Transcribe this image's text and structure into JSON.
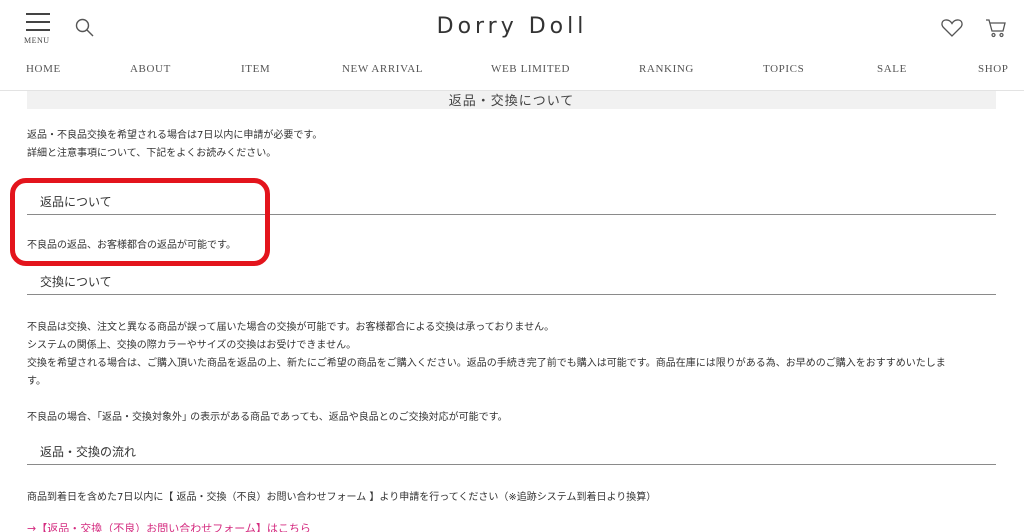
{
  "header": {
    "menu_label": "MENU",
    "logo": "Dorry Doll",
    "nav": [
      "HOME",
      "ABOUT",
      "ITEM",
      "NEW ARRIVAL",
      "WEB LIMITED",
      "RANKING",
      "TOPICS",
      "SALE",
      "SHOP"
    ]
  },
  "page_title": "返品・交換について",
  "intro": [
    "返品・不良品交換を希望される場合は7日以内に申請が必要です。",
    "詳細と注意事項について、下記をよくお読みください。"
  ],
  "sections": {
    "returns": {
      "heading": "返品について",
      "body": "不良品の返品、お客様都合の返品が可能です。"
    },
    "exchange": {
      "heading": "交換について",
      "lines": [
        "不良品は交換、注文と異なる商品が誤って届いた場合の交換が可能です。お客様都合による交換は承っておりません。",
        "システムの関係上、交換の際カラーやサイズの交換はお受けできません。",
        "交換を希望される場合は、ご購入頂いた商品を返品の上、新たにご希望の商品をご購入ください。返品の手続き完了前でも購入は可能です。商品在庫には限りがある為、お早めのご購入をおすすめいたしま",
        "す。",
        "不良品の場合、｢返品・交換対象外｣ の表示がある商品であっても、返品や良品とのご交換対応が可能です。"
      ]
    },
    "flow": {
      "heading": "返品・交換の流れ",
      "body": "商品到着日を含めた7日以内に【 返品・交換（不良）お問い合わせフォーム 】より申請を行ってください（※追跡システム到着日より換算）",
      "link": "→【返品・交換（不良）お問い合わせフォーム】はこちら"
    }
  },
  "colors": {
    "highlight": "#e3141c",
    "link": "#d42a7f",
    "title_bg": "#f1f1f1"
  }
}
